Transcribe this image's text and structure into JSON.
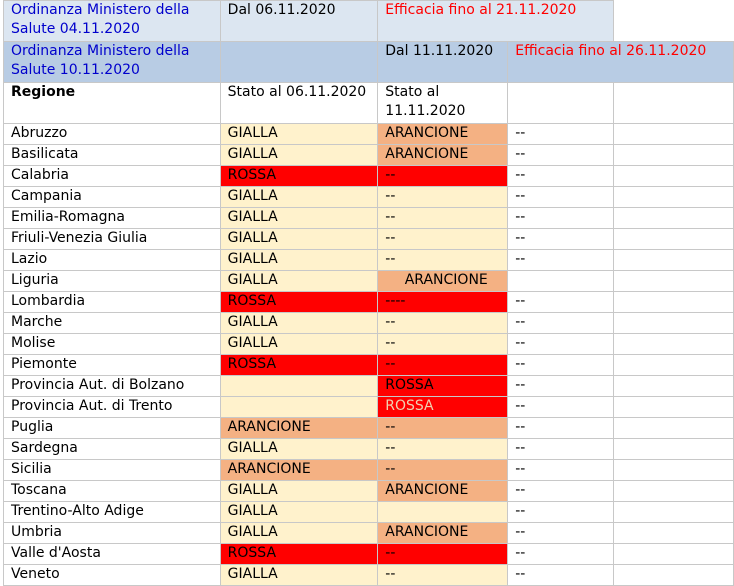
{
  "header": {
    "ord1_title": "Ordinanza Ministero della Salute 04.11.2020",
    "ord1_from": "Dal 06.11.2020",
    "ord1_until": "Efficacia fino al 21.11.2020",
    "ord2_title": "Ordinanza Ministero della Salute 10.11.2020",
    "ord2_from": "Dal 11.11.2020",
    "ord2_until": "Efficacia fino al 26.11.2020",
    "col_region": "Regione",
    "col_state1": "Stato al 06.11.2020",
    "col_state2": "Stato al 11.11.2020"
  },
  "rows": [
    {
      "region": "Abruzzo",
      "s1": "GIALLA",
      "s2": "ARANCIONE",
      "s3": "--"
    },
    {
      "region": "Basilicata",
      "s1": "GIALLA",
      "s2": "ARANCIONE",
      "s3": "--"
    },
    {
      "region": "Calabria",
      "s1": "ROSSA",
      "s2": "--",
      "s3": "--"
    },
    {
      "region": "Campania",
      "s1": "GIALLA",
      "s2": "--",
      "s3": "--"
    },
    {
      "region": "Emilia-Romagna",
      "s1": "GIALLA",
      "s2": "--",
      "s3": "--"
    },
    {
      "region": "Friuli-Venezia Giulia",
      "s1": "GIALLA",
      "s2": "--",
      "s3": "--"
    },
    {
      "region": "Lazio",
      "s1": "GIALLA",
      "s2": "--",
      "s3": "--"
    },
    {
      "region": "Liguria",
      "s1": "GIALLA",
      "s2": "ARANCIONE",
      "s3": ""
    },
    {
      "region": "Lombardia",
      "s1": "ROSSA",
      "s2": "----",
      "s3": "--"
    },
    {
      "region": "Marche",
      "s1": "GIALLA",
      "s2": "--",
      "s3": "--"
    },
    {
      "region": "Molise",
      "s1": "GIALLA",
      "s2": "--",
      "s3": "--"
    },
    {
      "region": "Piemonte",
      "s1": "ROSSA",
      "s2": "--",
      "s3": "--"
    },
    {
      "region": "Provincia Aut. di Bolzano",
      "s1": "",
      "s2": "ROSSA",
      "s3": "--"
    },
    {
      "region": "Provincia Aut. di Trento",
      "s1": "",
      "s2": "ROSSA",
      "s3": "--"
    },
    {
      "region": "Puglia",
      "s1": "ARANCIONE",
      "s2": "--",
      "s3": "--"
    },
    {
      "region": "Sardegna",
      "s1": "GIALLA",
      "s2": "--",
      "s3": "--"
    },
    {
      "region": "Sicilia",
      "s1": "ARANCIONE",
      "s2": "--",
      "s3": "--"
    },
    {
      "region": "Toscana",
      "s1": "GIALLA",
      "s2": "ARANCIONE",
      "s3": "--"
    },
    {
      "region": "Trentino-Alto Adige",
      "s1": "GIALLA",
      "s2": "",
      "s3": "--"
    },
    {
      "region": "Umbria",
      "s1": "GIALLA",
      "s2": "ARANCIONE",
      "s3": "--"
    },
    {
      "region": "Valle d'Aosta",
      "s1": "ROSSA",
      "s2": "--",
      "s3": "--"
    },
    {
      "region": "Veneto",
      "s1": "GIALLA",
      "s2": "--",
      "s3": "--"
    }
  ],
  "colors": {
    "gialla": "#fff2cc",
    "arancione": "#f4b183",
    "rossa": "#ff0000",
    "header_light_blue": "#dce6f1",
    "header_blue": "#b8cce4",
    "link_blue": "#0000cc",
    "efficacia_red": "#ff0000"
  }
}
